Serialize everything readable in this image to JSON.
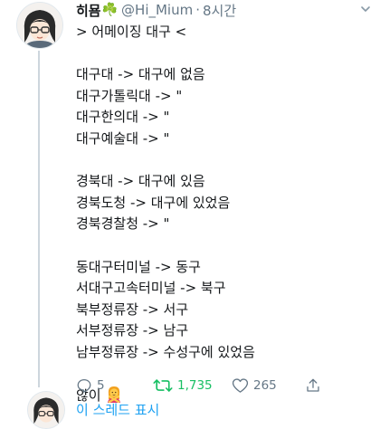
{
  "author": {
    "name": "히묨",
    "badge": "☘️",
    "handle": "@Hi_Mium",
    "separator": "·",
    "time": "8시간"
  },
  "tweet": {
    "lines": [
      "> 어메이징 대구 <",
      "",
      "대구대 -> 대구에 없음",
      "대구가톨릭대 -> \"",
      "대구한의대 -> \"",
      "대구예술대 -> \"",
      "",
      "경북대 -> 대구에 있음",
      "경북도청 -> 대구에 있었음",
      "경북경찰청 -> \"",
      "",
      "동대구터미널 -> 동구",
      "서대구고속터미널 -> 북구",
      "북부정류장 -> 서구",
      "서부정류장 -> 남구",
      "남부정류장 -> 수성구에 있었음",
      "",
      "않이"
    ],
    "emoji": "woman-gesturing-no"
  },
  "actions": {
    "replies": "5",
    "retweets": "1,735",
    "likes": "265",
    "retweet_color": "#17bf63",
    "icon_color": "#657786"
  },
  "show_thread": "이 스레드 표시",
  "colors": {
    "link": "#1da1f2",
    "text": "#14171a",
    "muted": "#657786"
  }
}
